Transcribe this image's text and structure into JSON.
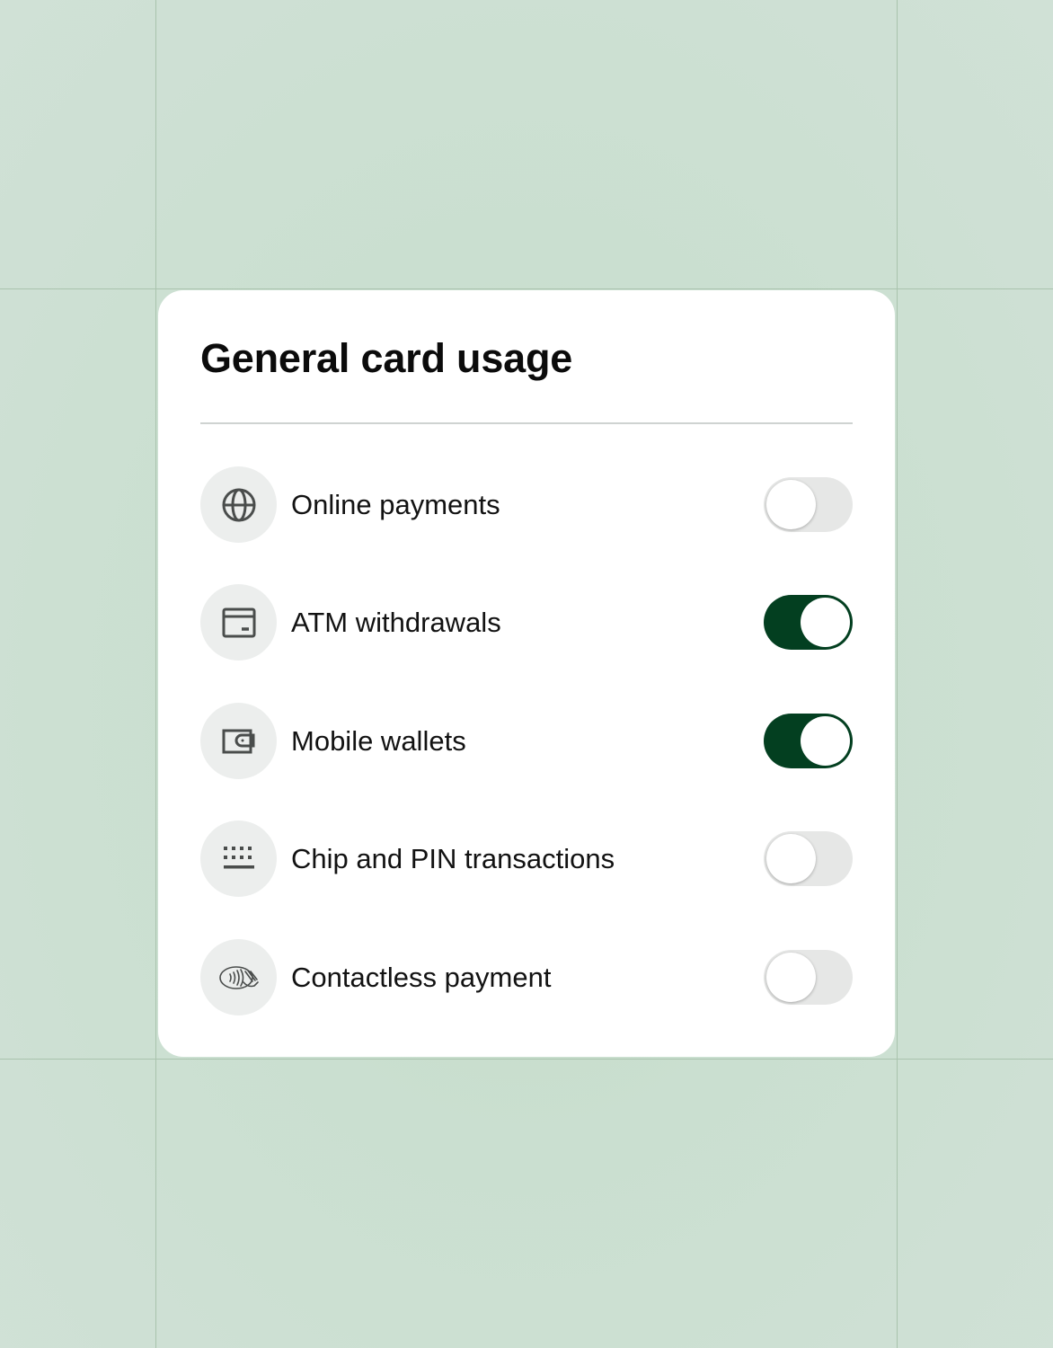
{
  "colors": {
    "accent": "#033f20",
    "toggle_off": "#e6e7e6",
    "icon_bg": "#eceeed",
    "background": "#cadfd0"
  },
  "card": {
    "title": "General card usage",
    "settings": [
      {
        "label": "Online payments",
        "icon": "globe-icon",
        "enabled": false
      },
      {
        "label": "ATM withdrawals",
        "icon": "atm-icon",
        "enabled": true
      },
      {
        "label": "Mobile wallets",
        "icon": "wallet-icon",
        "enabled": true
      },
      {
        "label": "Chip and PIN transactions",
        "icon": "keypad-icon",
        "enabled": false
      },
      {
        "label": "Contactless payment",
        "icon": "contactless-icon",
        "enabled": false
      }
    ]
  }
}
